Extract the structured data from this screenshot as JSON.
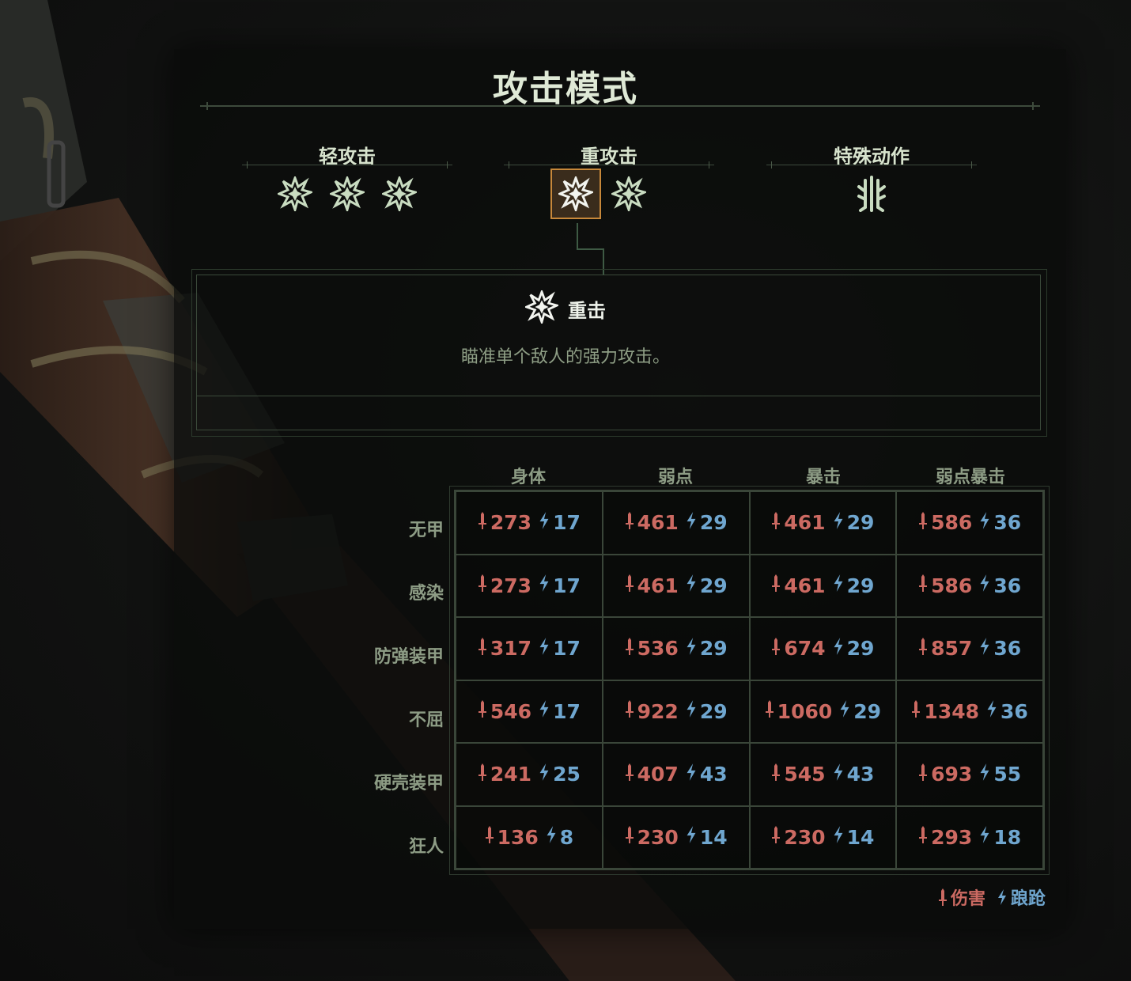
{
  "screen": {
    "title": "攻击模式"
  },
  "modes": [
    {
      "label": "轻攻击",
      "icons": [
        "impact-icon",
        "impact-icon",
        "impact-icon"
      ]
    },
    {
      "label": "重攻击",
      "icons": [
        "impact-icon-selected",
        "impact-icon"
      ]
    },
    {
      "label": "特殊动作",
      "icons": [
        "special-move-icon"
      ]
    }
  ],
  "detail": {
    "icon": "impact-icon",
    "name": "重击",
    "description": "瞄准单个敌人的强力攻击。"
  },
  "table": {
    "columns": [
      "身体",
      "弱点",
      "暴击",
      "弱点暴击"
    ],
    "rows": [
      {
        "label": "无甲",
        "cells": [
          [
            "273",
            "17"
          ],
          [
            "461",
            "29"
          ],
          [
            "461",
            "29"
          ],
          [
            "586",
            "36"
          ]
        ]
      },
      {
        "label": "感染",
        "cells": [
          [
            "273",
            "17"
          ],
          [
            "461",
            "29"
          ],
          [
            "461",
            "29"
          ],
          [
            "586",
            "36"
          ]
        ]
      },
      {
        "label": "防弹装甲",
        "cells": [
          [
            "317",
            "17"
          ],
          [
            "536",
            "29"
          ],
          [
            "674",
            "29"
          ],
          [
            "857",
            "36"
          ]
        ]
      },
      {
        "label": "不屈",
        "cells": [
          [
            "546",
            "17"
          ],
          [
            "922",
            "29"
          ],
          [
            "1060",
            "29"
          ],
          [
            "1348",
            "36"
          ]
        ]
      },
      {
        "label": "硬壳装甲",
        "cells": [
          [
            "241",
            "25"
          ],
          [
            "407",
            "43"
          ],
          [
            "545",
            "43"
          ],
          [
            "693",
            "55"
          ]
        ]
      },
      {
        "label": "狂人",
        "cells": [
          [
            "136",
            "8"
          ],
          [
            "230",
            "14"
          ],
          [
            "230",
            "14"
          ],
          [
            "293",
            "18"
          ]
        ]
      }
    ]
  },
  "legend": {
    "damage": "伤害",
    "stagger": "踉跄",
    "damage_color": "#cc6a62",
    "stagger_color": "#6fa6cf"
  },
  "colors": {
    "accent_selected": "#c7883a",
    "title": "#dfe9d6",
    "icon_green": "#c9dcc1"
  }
}
